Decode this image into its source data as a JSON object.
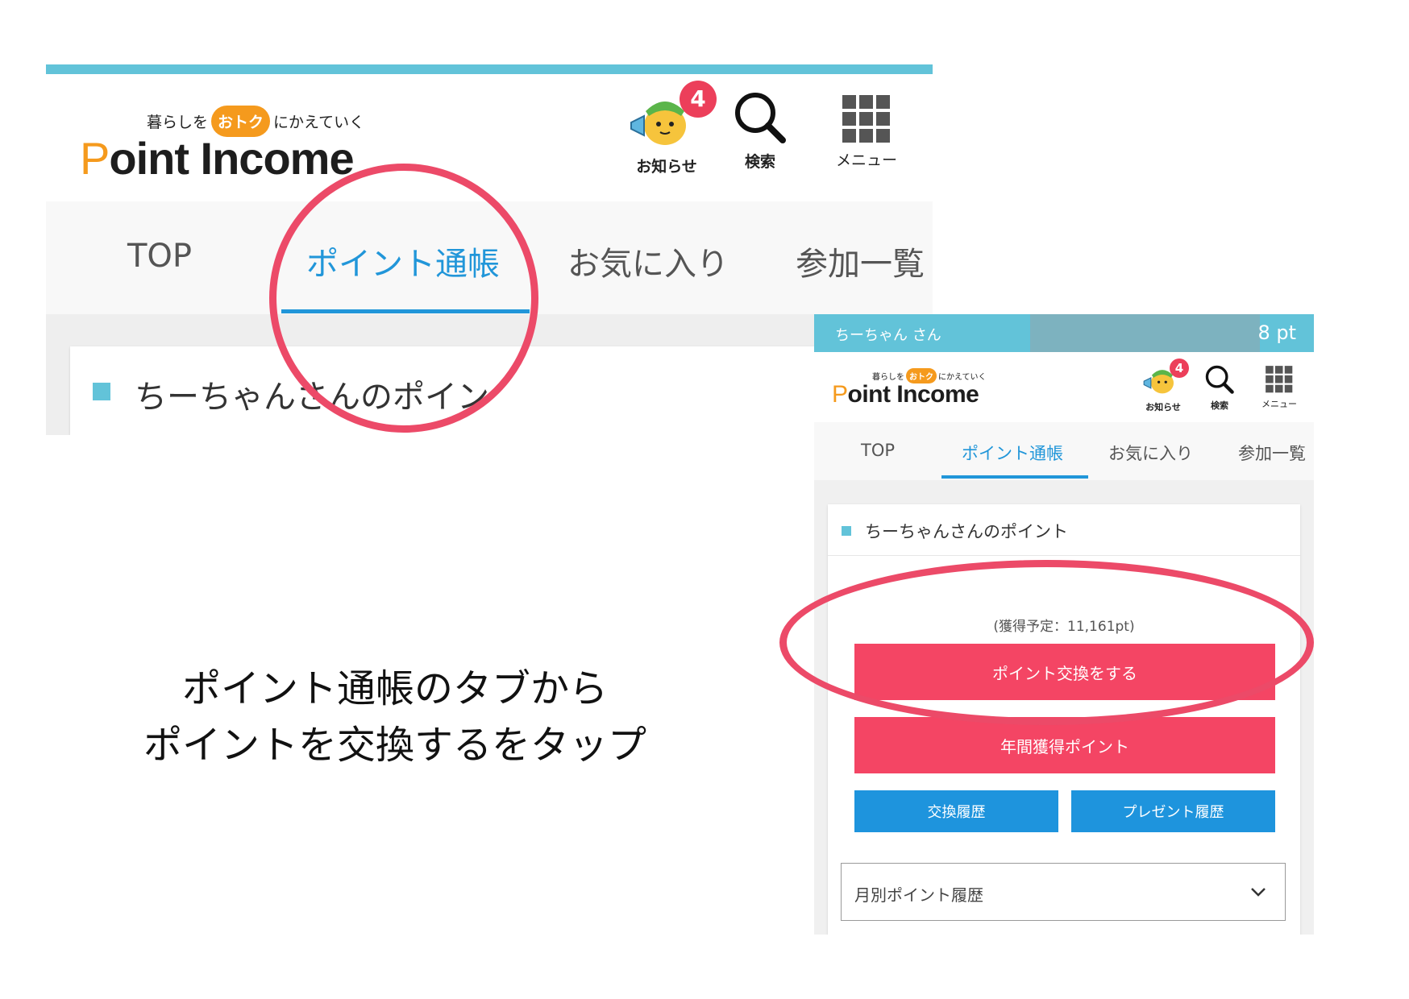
{
  "brand": {
    "tagline_pre": "暮らしを",
    "tagline_highlight": "おトク",
    "tagline_post": "にかえていく",
    "logo_initial": "P",
    "logo_rest": "oint Income"
  },
  "header_icons": {
    "notify_label": "お知らせ",
    "notify_badge": "4",
    "search_label": "検索",
    "menu_label": "メニュー"
  },
  "tabs": [
    {
      "label": "TOP"
    },
    {
      "label": "ポイント通帳"
    },
    {
      "label": "お気に入り"
    },
    {
      "label": "参加一覧"
    }
  ],
  "section_title": "ちーちゃんさんのポイント",
  "zoom_section_title": "ちーちゃんさんのポイン",
  "user_bar": {
    "name": "ちーちゃん さん",
    "points": "8 pt"
  },
  "points_panel": {
    "pending": "(獲得予定：11,161pt)",
    "exchange_button": "ポイント交換をする",
    "annual_button": "年間獲得ポイント",
    "exchange_history_button": "交換履歴",
    "present_history_button": "プレゼント履歴",
    "monthly_select": "月別ポイント履歴"
  },
  "instruction": {
    "line1": "ポイント通帳のタブから",
    "line2": "ポイントを交換するをタップ"
  },
  "colors": {
    "accent_blue": "#2196d9",
    "top_bar": "#62c3d9",
    "button_pink": "#f44564",
    "button_blue": "#1e94dd",
    "highlight_ring": "#ec4a68",
    "logo_orange": "#f59a1d"
  }
}
